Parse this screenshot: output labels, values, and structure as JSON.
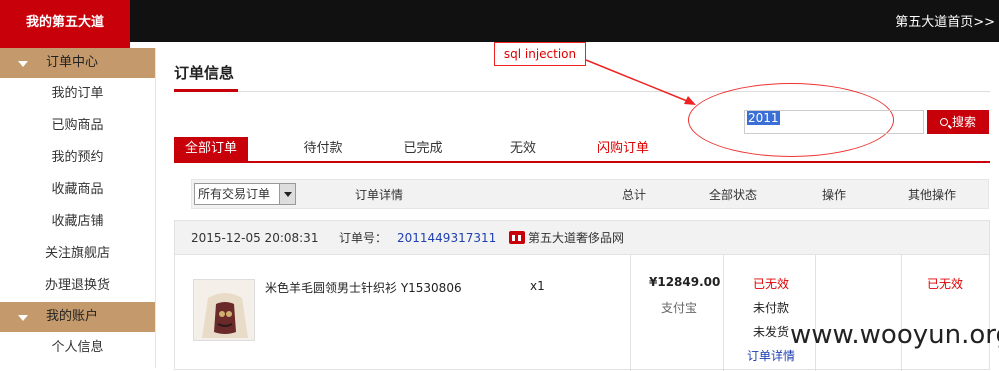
{
  "header": {
    "brand": "我的第五大道",
    "home_link": "第五大道首页>>"
  },
  "sidebar": {
    "sections": [
      {
        "title": "订单中心",
        "items": [
          "我的订单",
          "已购商品",
          "我的预约",
          "收藏商品",
          "收藏店铺",
          "关注旗舰店",
          "办理退换货"
        ]
      },
      {
        "title": "我的账户",
        "items": [
          "个人信息"
        ]
      }
    ]
  },
  "main": {
    "title": "订单信息",
    "annotation": "sql injection",
    "search": {
      "value": "2011",
      "button": "搜索"
    },
    "tabs": [
      "全部订单",
      "待付款",
      "已完成",
      "无效",
      "闪购订单"
    ],
    "table_header": {
      "filter_select": "所有交易订单",
      "details": "订单详情",
      "total": "总计",
      "status": "全部状态",
      "action": "操作",
      "other": "其他操作"
    },
    "order": {
      "date": "2015-12-05 20:08:31",
      "number_label": "订单号：",
      "number": "2011449317311",
      "shop": "第五大道奢侈品网",
      "product_name": "米色羊毛圆领男士针织衫 Y1530806",
      "quantity": "x1",
      "price": "¥12849.00",
      "payment": "支付宝",
      "status_invalid": "已无效",
      "status_unpaid": "未付款",
      "status_unshipped": "未发货",
      "details_link": "订单详情",
      "other_status": "已无效"
    }
  },
  "watermark": "www.wooyun.org",
  "colors": {
    "brand_red": "#c8000a",
    "sidebar_head": "#c49a6c",
    "topbar": "#111111",
    "link_blue": "#2040b0"
  }
}
